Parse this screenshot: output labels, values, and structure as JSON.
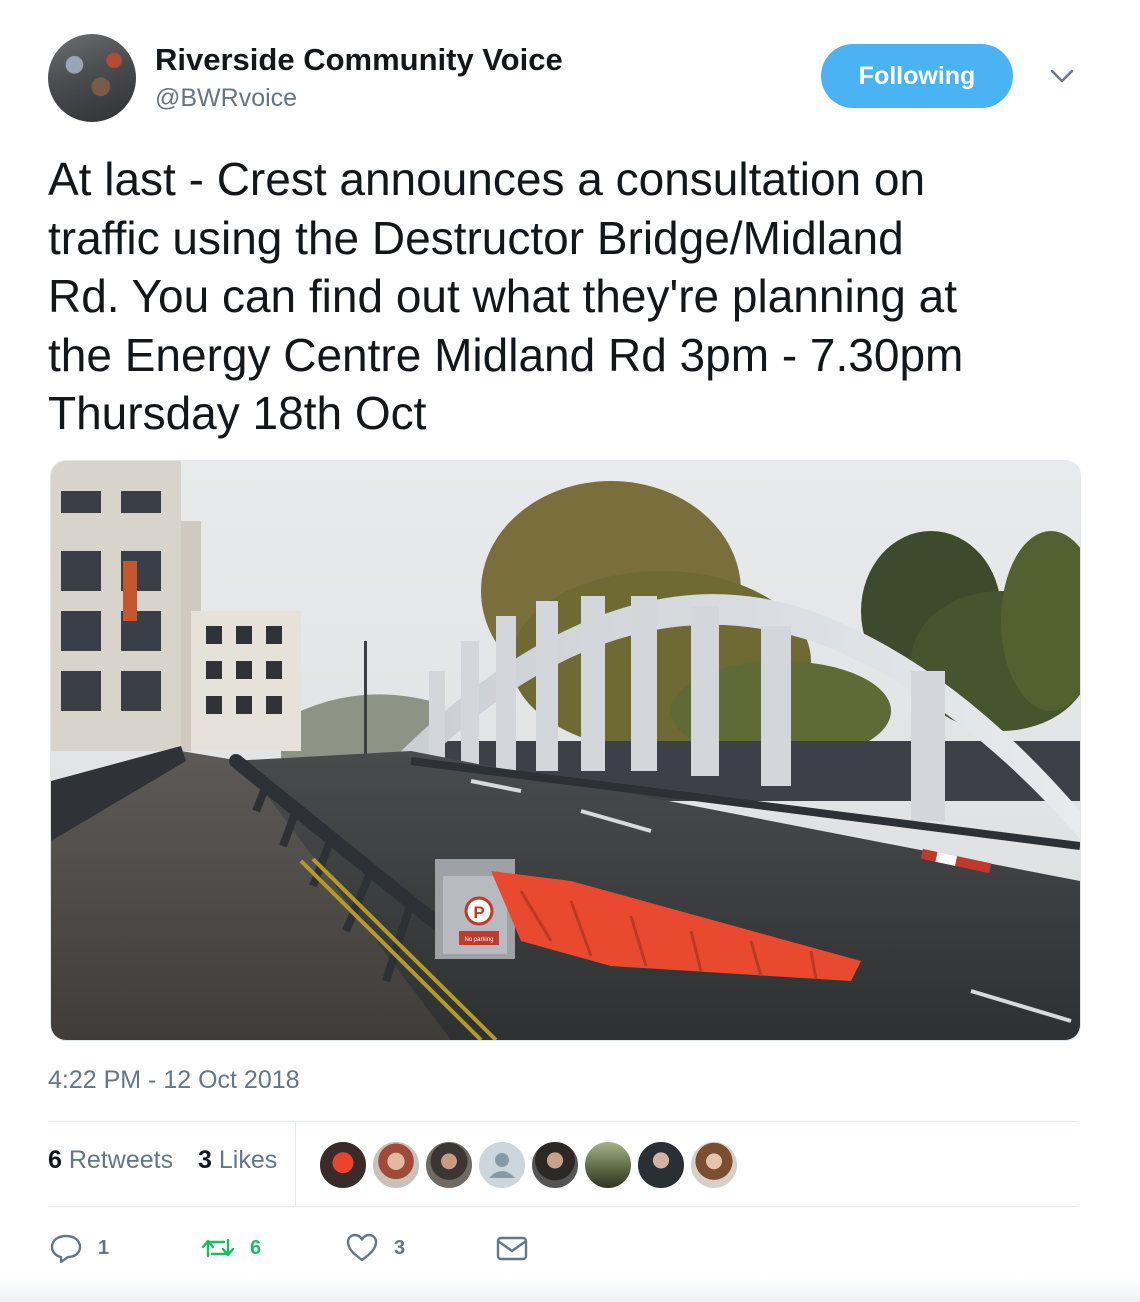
{
  "author": {
    "name": "Riverside Community Voice",
    "handle": "@BWRvoice"
  },
  "follow_button_label": "Following",
  "tweet": {
    "lines": [
      "At last - Crest announces a consultation on",
      "traffic using the Destructor Bridge/Midland",
      "Rd. You can find out what they're planning at",
      "the Energy Centre Midland Rd 3pm - 7.30pm",
      "Thursday 18th Oct"
    ],
    "timestamp": "4:22 PM - 12 Oct 2018"
  },
  "photo": {
    "sign_letter": "P",
    "sign_subtext": "No parking"
  },
  "stats": {
    "retweets_count": "6",
    "retweets_label": "Retweets",
    "likes_count": "3",
    "likes_label": "Likes"
  },
  "actions": {
    "reply_count": "1",
    "retweet_count": "6",
    "like_count": "3"
  },
  "colors": {
    "accent": "#4ab3f4",
    "retweet": "#17bf63",
    "secondary_text": "#657786"
  },
  "icons": [
    "reply-icon",
    "retweet-icon",
    "heart-icon",
    "envelope-icon",
    "chevron-down-icon"
  ]
}
